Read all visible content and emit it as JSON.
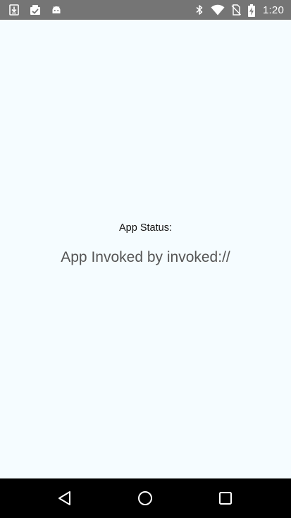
{
  "status_bar": {
    "left_icons": [
      "download-icon",
      "clipboard-check-icon",
      "android-icon"
    ],
    "right_icons": [
      "bluetooth-icon",
      "wifi-icon",
      "no-sim-icon",
      "battery-charging-icon"
    ],
    "time": "1:20",
    "background": "#757575"
  },
  "main": {
    "status_label": "App Status:",
    "status_value": "App Invoked by invoked://",
    "background": "#f5fcff"
  },
  "nav_bar": {
    "buttons": [
      "back-icon",
      "home-icon",
      "recents-icon"
    ],
    "background": "#000000"
  }
}
